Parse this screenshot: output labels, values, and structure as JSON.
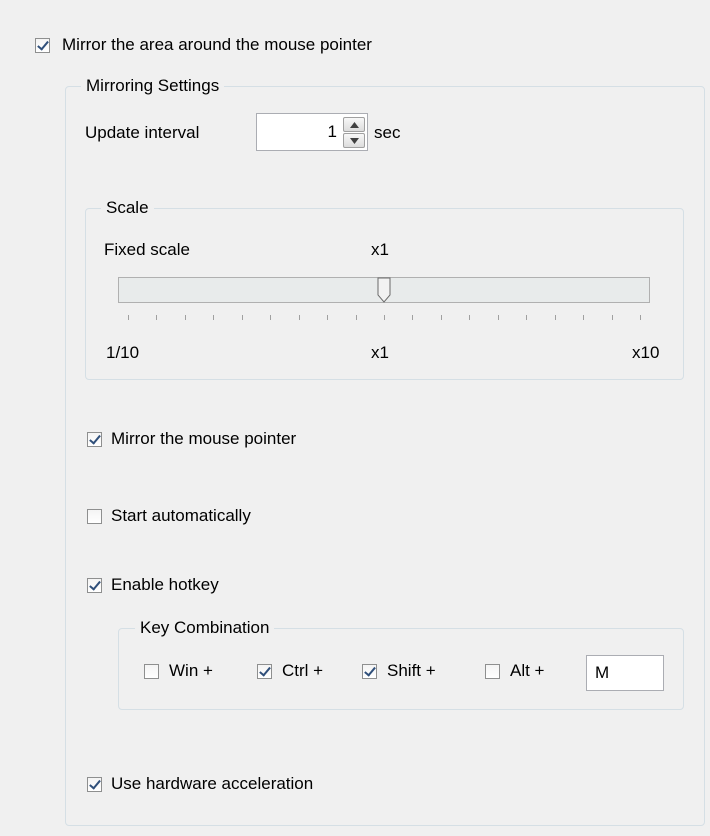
{
  "mirror_area": {
    "label": "Mirror the area around the mouse pointer",
    "checked": true
  },
  "mirroring_settings": {
    "legend": "Mirroring Settings",
    "update_interval": {
      "label": "Update interval",
      "value": "1",
      "unit": "sec"
    },
    "scale": {
      "legend": "Scale",
      "fixed_scale_label": "Fixed scale",
      "current_value": "x1",
      "slider_position": 0.5,
      "tick_count": 19,
      "tick_labels": {
        "min": "1/10",
        "mid": "x1",
        "max": "x10"
      }
    },
    "mirror_pointer": {
      "label": "Mirror the mouse pointer",
      "checked": true
    },
    "start_auto": {
      "label": "Start automatically",
      "checked": false
    },
    "enable_hotkey": {
      "label": "Enable hotkey",
      "checked": true
    },
    "key_combination": {
      "legend": "Key Combination",
      "win": {
        "label": "Win +",
        "checked": false
      },
      "ctrl": {
        "label": "Ctrl +",
        "checked": true
      },
      "shift": {
        "label": "Shift +",
        "checked": true
      },
      "alt": {
        "label": "Alt +",
        "checked": false
      },
      "key": "M"
    },
    "hardware_accel": {
      "label": "Use hardware acceleration",
      "checked": true
    }
  },
  "icons": {
    "spin_up": "chevron-up-icon",
    "spin_down": "chevron-down-icon",
    "slider_thumb": "slider-thumb-icon"
  },
  "colors": {
    "background": "#f0f0f0",
    "checkmark": "#2f4f7a",
    "group_border": "#d5dfe5"
  }
}
